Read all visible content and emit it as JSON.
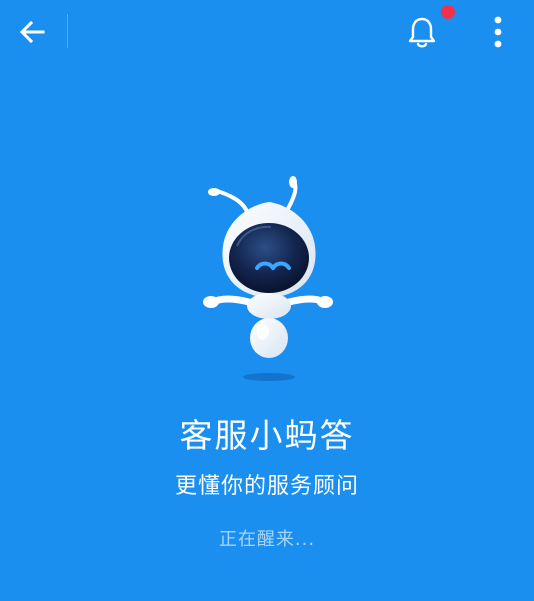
{
  "colors": {
    "background": "#1a8ff0",
    "badge": "#f2314c",
    "mascot_visor": "#0d1a3a",
    "mascot_body": "#ffffff"
  },
  "topbar": {
    "back_icon": "arrow-left-icon",
    "notification_icon": "bell-icon",
    "more_icon": "more-vertical-icon"
  },
  "main": {
    "title": "客服小蚂答",
    "subtitle": "更懂你的服务顾问",
    "status": "正在醒来..."
  }
}
